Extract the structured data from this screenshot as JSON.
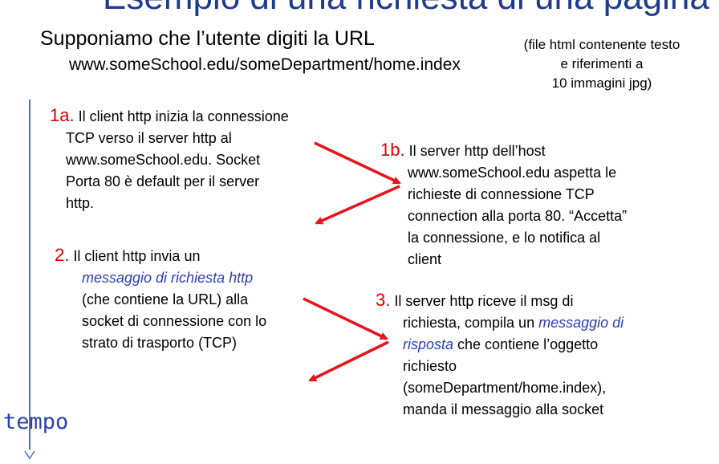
{
  "slide": {
    "title_partial": "Esempio di una richiesta di una pagina",
    "subtitle": "Supponiamo che l’utente digiti la URL",
    "url": "www.someSchool.edu/someDepartment/home.index",
    "note_lines": [
      "(file html contenente testo",
      "e riferimenti a",
      "10 immagini jpg)"
    ],
    "time_label": "tempo"
  },
  "steps": {
    "s1a": {
      "num": "1a.",
      "first": "Il client http inizia la connessione",
      "lines": [
        "TCP verso il server http  al",
        "www.someSchool.edu. Socket",
        "Porta 80 è default per il server",
        "http."
      ]
    },
    "s1b": {
      "num": "1b.",
      "first": "Il server http dell’host",
      "lines": [
        "www.someSchool.edu aspetta le",
        "richieste di connessione TCP",
        "connection alla porta 80.  “Accetta”",
        "la connessione, e lo notifica al",
        "client"
      ]
    },
    "s2": {
      "num": "2.",
      "first": "Il client http invia un",
      "emph": "messaggio di richiesta http",
      "lines": [
        "(che contiene la URL) alla",
        "socket di connessione con lo",
        "strato di trasporto (TCP)"
      ]
    },
    "s3": {
      "num": "3.",
      "first": "Il server http riceve il msg di",
      "line2_pre": "richiesta, compila un ",
      "line2_emph": "messaggio di",
      "line3_emph": "risposta",
      "line3_post": " che contiene l’oggetto",
      "lines": [
        "richiesto",
        "(someDepartment/home.index),",
        "manda il messaggio alla socket"
      ]
    }
  },
  "colors": {
    "accent_red": "#e00000",
    "accent_blue": "#2b3fb5",
    "arrow_red": "#e8141c"
  }
}
